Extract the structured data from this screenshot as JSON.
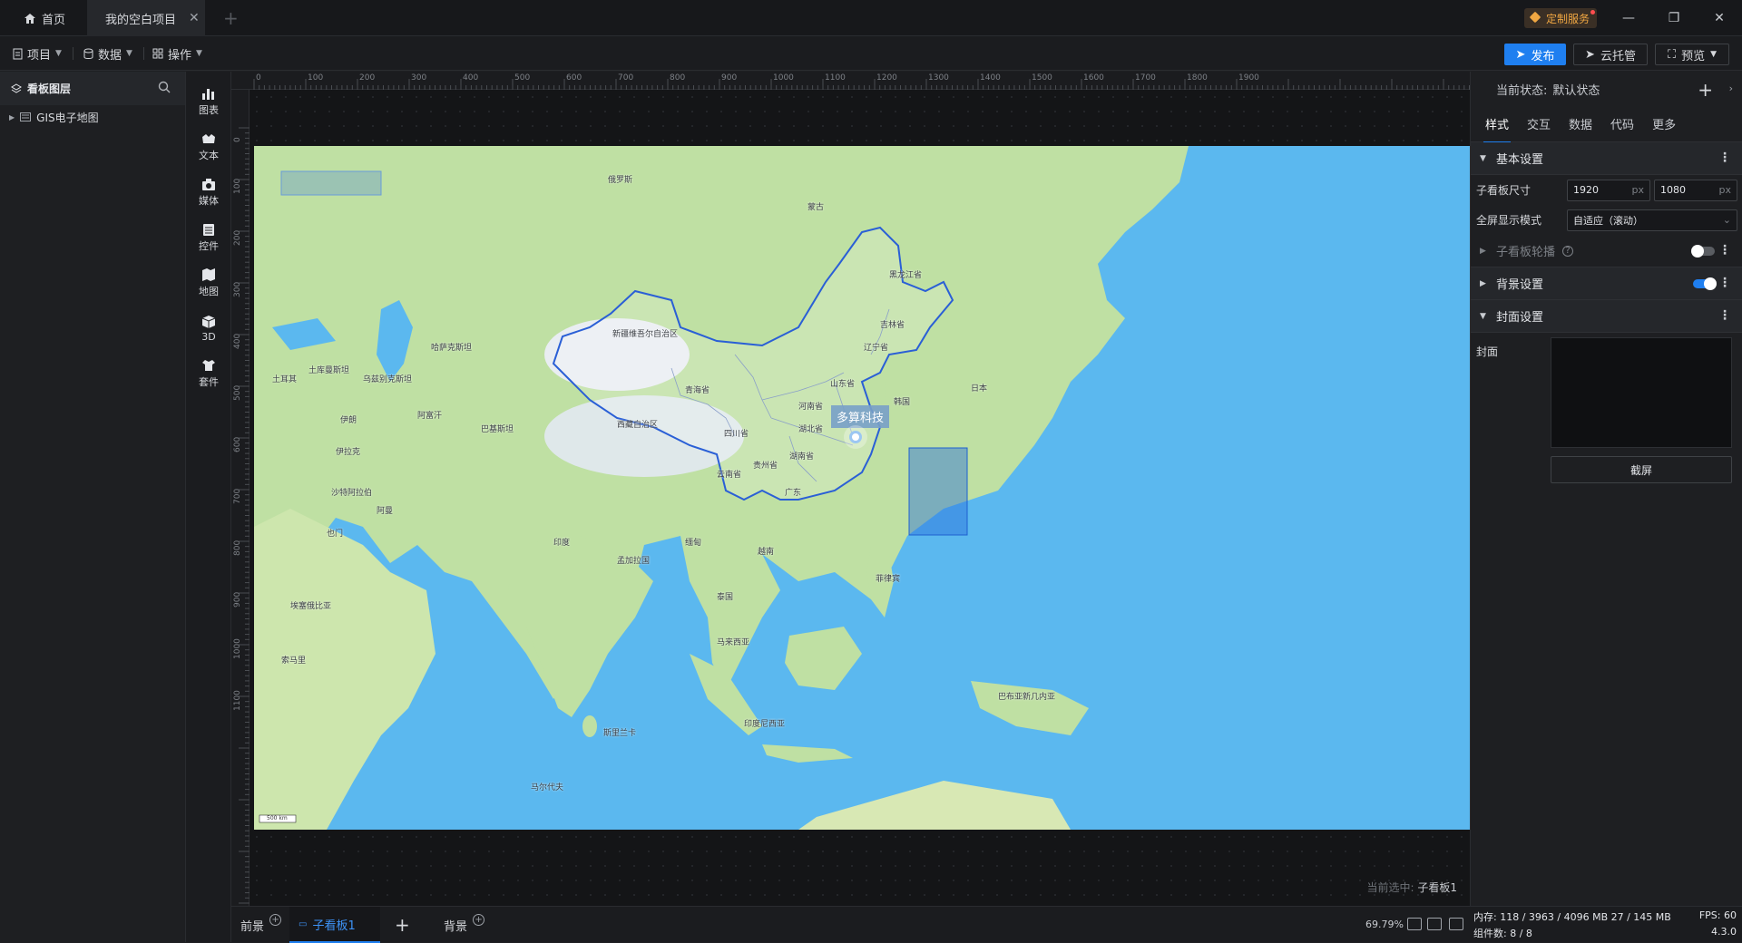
{
  "titlebar": {
    "home_tab": "首页",
    "project_tab": "我的空白项目",
    "custom_service": "定制服务"
  },
  "toolbar": {
    "menu_project": "项目",
    "menu_data": "数据",
    "menu_operation": "操作",
    "publish": "发布",
    "cloud_host": "云托管",
    "preview": "预览"
  },
  "layers": {
    "title": "看板图层",
    "items": [
      {
        "label": "GIS电子地图",
        "icon": "map-layer-icon"
      }
    ]
  },
  "widgets": [
    {
      "label": "图表",
      "icon": "chart-icon"
    },
    {
      "label": "文本",
      "icon": "text-icon"
    },
    {
      "label": "媒体",
      "icon": "media-icon"
    },
    {
      "label": "控件",
      "icon": "control-icon"
    },
    {
      "label": "地图",
      "icon": "map-icon"
    },
    {
      "label": "3D",
      "icon": "cube-icon"
    },
    {
      "label": "套件",
      "icon": "kit-icon"
    }
  ],
  "ruler": {
    "h_ticks": [
      "0",
      "100",
      "200",
      "300",
      "400",
      "500",
      "600",
      "700",
      "800",
      "900",
      "1000",
      "1100",
      "1200",
      "1300",
      "1400",
      "1500",
      "1600",
      "1700",
      "1800",
      "1900"
    ],
    "v_ticks": [
      "0",
      "100",
      "200",
      "300",
      "400",
      "500",
      "600",
      "700",
      "800",
      "900",
      "1000",
      "1100"
    ]
  },
  "map": {
    "marker_label": "多算科技",
    "labels": [
      "新疆维吾尔自治区",
      "西藏自治区",
      "青海省",
      "四川省",
      "云南省",
      "黑龙江省",
      "吉林省",
      "辽宁省",
      "山东省",
      "河南省",
      "湖北省",
      "湖南省",
      "贵州省",
      "广东",
      "哈萨克斯坦",
      "乌兹别克斯坦",
      "土库曼斯坦",
      "阿富汗",
      "巴基斯坦",
      "伊朗",
      "沙特阿拉伯",
      "印度",
      "孟加拉国",
      "缅甸",
      "泰国",
      "越南",
      "马来西亚",
      "印度尼西亚",
      "日本",
      "韩国",
      "菲律宾",
      "巴布亚新几内亚",
      "土耳其",
      "伊拉克",
      "也门",
      "阿曼",
      "斯里兰卡",
      "马尔代夫",
      "索马里",
      "埃塞俄比亚",
      "俄罗斯",
      "蒙古"
    ],
    "scale": "500 km"
  },
  "canvas": {
    "selected_prefix": "当前选中:",
    "selected_value": "子看板1"
  },
  "bottom": {
    "foreground": "前景",
    "sub_board": "子看板1",
    "background": "背景",
    "zoom": "69.79%"
  },
  "props": {
    "state_label": "当前状态:",
    "state_value": "默认状态",
    "tabs": [
      "样式",
      "交互",
      "数据",
      "代码",
      "更多"
    ],
    "section_basic": "基本设置",
    "size_label": "子看板尺寸",
    "width": "1920",
    "height": "1080",
    "unit": "px",
    "fullscreen_label": "全屏显示模式",
    "fullscreen_value": "自适应（滚动）",
    "carousel_label": "子看板轮播",
    "bg_label": "背景设置",
    "cover_section": "封面设置",
    "cover_label": "封面",
    "capture": "截屏"
  },
  "status": {
    "memory": "内存:  118 / 3963 / 4096 MB  27 / 145 MB",
    "fps": "FPS:  60",
    "components": "组件数: 8 / 8",
    "version": "4.3.0"
  },
  "colors": {
    "accent": "#1f7ff0",
    "ocean": "#5bb8ef",
    "land": "#bfe0a3",
    "china_border": "#2a5fd6"
  }
}
